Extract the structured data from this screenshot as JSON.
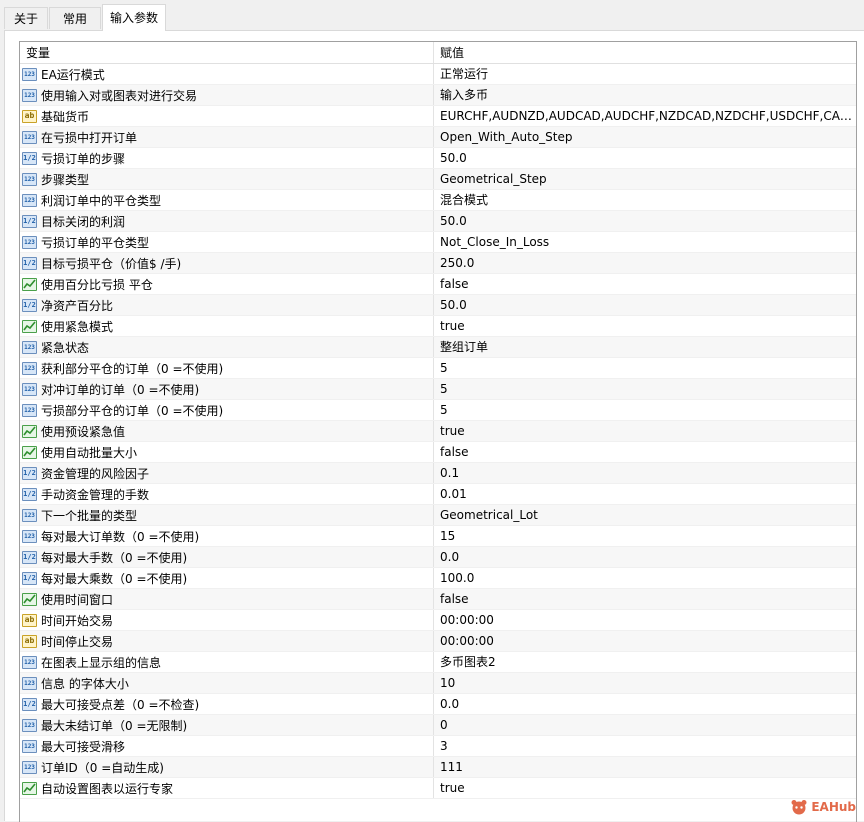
{
  "tabs": {
    "about": "关于",
    "common": "常用",
    "inputs": "输入参数"
  },
  "table": {
    "col_variable": "变量",
    "col_value": "赋值"
  },
  "rows": [
    {
      "type": "int",
      "icon_text": "123",
      "name": "EA运行模式",
      "value": "正常运行"
    },
    {
      "type": "int",
      "icon_text": "123",
      "name": "使用输入对或图表对进行交易",
      "value": "输入多币"
    },
    {
      "type": "str",
      "icon_text": "ab",
      "name": "基础货币",
      "value": "EURCHF,AUDNZD,AUDCAD,AUDCHF,NZDCAD,NZDCHF,USDCHF,CADC..."
    },
    {
      "type": "int",
      "icon_text": "123",
      "name": "在亏损中打开订单",
      "value": "Open_With_Auto_Step"
    },
    {
      "type": "dbl",
      "icon_text": "1/2",
      "name": "亏损订单的步骤",
      "value": "50.0"
    },
    {
      "type": "int",
      "icon_text": "123",
      "name": "步骤类型",
      "value": "Geometrical_Step"
    },
    {
      "type": "int",
      "icon_text": "123",
      "name": "利润订单中的平仓类型",
      "value": "混合模式"
    },
    {
      "type": "dbl",
      "icon_text": "1/2",
      "name": "目标关闭的利润",
      "value": "50.0"
    },
    {
      "type": "int",
      "icon_text": "123",
      "name": "亏损订单的平仓类型",
      "value": "Not_Close_In_Loss"
    },
    {
      "type": "dbl",
      "icon_text": "1/2",
      "name": "目标亏损平仓（价值$ /手)",
      "value": "250.0"
    },
    {
      "type": "bool",
      "icon_text": "",
      "name": "使用百分比亏损 平仓",
      "value": "false"
    },
    {
      "type": "dbl",
      "icon_text": "1/2",
      "name": "净资产百分比",
      "value": "50.0"
    },
    {
      "type": "bool",
      "icon_text": "",
      "name": "使用紧急模式",
      "value": "true"
    },
    {
      "type": "int",
      "icon_text": "123",
      "name": "紧急状态",
      "value": "整组订单"
    },
    {
      "type": "int",
      "icon_text": "123",
      "name": "获利部分平仓的订单（0 =不使用)",
      "value": "5"
    },
    {
      "type": "int",
      "icon_text": "123",
      "name": "对冲订单的订单（0 =不使用)",
      "value": "5"
    },
    {
      "type": "int",
      "icon_text": "123",
      "name": "亏损部分平仓的订单（0 =不使用)",
      "value": "5"
    },
    {
      "type": "bool",
      "icon_text": "",
      "name": "使用预设紧急值",
      "value": "true"
    },
    {
      "type": "bool",
      "icon_text": "",
      "name": "使用自动批量大小",
      "value": "false"
    },
    {
      "type": "dbl",
      "icon_text": "1/2",
      "name": "资金管理的风险因子",
      "value": "0.1"
    },
    {
      "type": "dbl",
      "icon_text": "1/2",
      "name": "手动资金管理的手数",
      "value": "0.01"
    },
    {
      "type": "int",
      "icon_text": "123",
      "name": "下一个批量的类型",
      "value": "Geometrical_Lot"
    },
    {
      "type": "int",
      "icon_text": "123",
      "name": "每对最大订单数（0 =不使用)",
      "value": "15"
    },
    {
      "type": "dbl",
      "icon_text": "1/2",
      "name": "每对最大手数（0 =不使用)",
      "value": "0.0"
    },
    {
      "type": "dbl",
      "icon_text": "1/2",
      "name": "每对最大乘数（0 =不使用)",
      "value": "100.0"
    },
    {
      "type": "bool",
      "icon_text": "",
      "name": "使用时间窗口",
      "value": "false"
    },
    {
      "type": "str",
      "icon_text": "ab",
      "name": "时间开始交易",
      "value": "00:00:00"
    },
    {
      "type": "str",
      "icon_text": "ab",
      "name": "时间停止交易",
      "value": "00:00:00"
    },
    {
      "type": "int",
      "icon_text": "123",
      "name": "在图表上显示组的信息",
      "value": "多币图表2"
    },
    {
      "type": "int",
      "icon_text": "123",
      "name": "信息 的字体大小",
      "value": "10"
    },
    {
      "type": "dbl",
      "icon_text": "1/2",
      "name": "最大可接受点差（0 =不检查)",
      "value": "0.0"
    },
    {
      "type": "int",
      "icon_text": "123",
      "name": "最大未结订单（0 =无限制)",
      "value": "0"
    },
    {
      "type": "int",
      "icon_text": "123",
      "name": "最大可接受滑移",
      "value": "3"
    },
    {
      "type": "int",
      "icon_text": "123",
      "name": "订单ID（0 =自动生成)",
      "value": "111"
    },
    {
      "type": "bool",
      "icon_text": "",
      "name": "自动设置图表以运行专家",
      "value": "true"
    }
  ],
  "brand": {
    "text": "EAHub"
  },
  "colors": {
    "int_icon": "#1f5fa8",
    "bool_icon": "#4aa04a",
    "str_icon": "#c9a227",
    "brand": "#e26a4a"
  }
}
